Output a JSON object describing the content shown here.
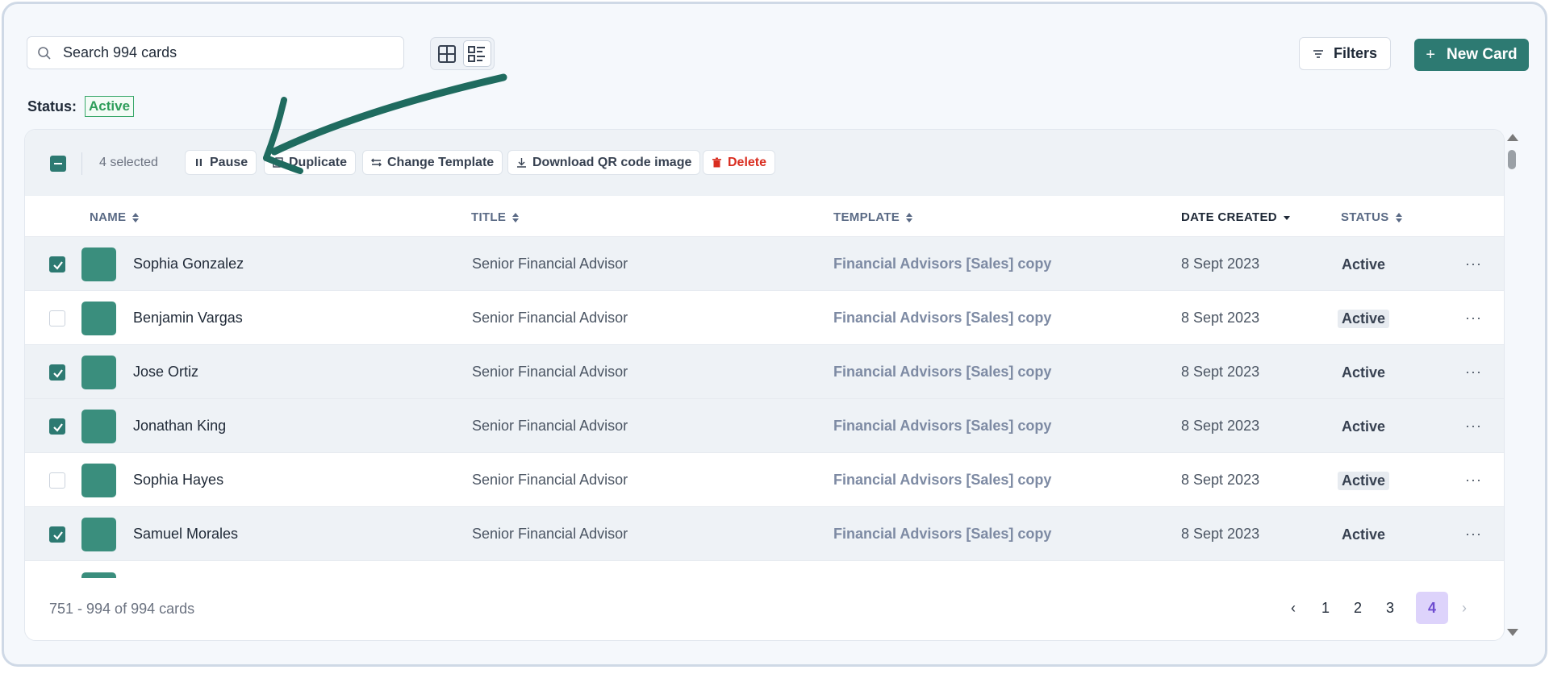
{
  "search": {
    "value": "Search 994 cards",
    "placeholder": "Search 994 cards"
  },
  "toolbar": {
    "filters_label": "Filters",
    "new_card_label": "New Card",
    "new_card_icon": "+"
  },
  "status_filter": {
    "label": "Status:",
    "value": "Active"
  },
  "bulk": {
    "selected_label": "4 selected",
    "actions": [
      {
        "label": "Pause",
        "icon": "pause-icon"
      },
      {
        "label": "Duplicate",
        "icon": "copy-icon"
      },
      {
        "label": "Change Template",
        "icon": "swap-icon"
      },
      {
        "label": "Download QR code image",
        "icon": "download-icon"
      },
      {
        "label": "Delete",
        "icon": "trash-icon"
      }
    ]
  },
  "table": {
    "columns": [
      "NAME",
      "TITLE",
      "TEMPLATE",
      "DATE CREATED",
      "STATUS"
    ],
    "sorted_column": "DATE CREATED",
    "rows": [
      {
        "name": "Sophia Gonzalez",
        "title": "Senior Financial Advisor",
        "template": "Financial Advisors [Sales] copy",
        "date": "8 Sept 2023",
        "status": "Active",
        "selected": true
      },
      {
        "name": "Benjamin Vargas",
        "title": "Senior Financial Advisor",
        "template": "Financial Advisors [Sales] copy",
        "date": "8 Sept 2023",
        "status": "Active",
        "selected": false
      },
      {
        "name": "Jose Ortiz",
        "title": "Senior Financial Advisor",
        "template": "Financial Advisors [Sales] copy",
        "date": "8 Sept 2023",
        "status": "Active",
        "selected": true
      },
      {
        "name": "Jonathan King",
        "title": "Senior Financial Advisor",
        "template": "Financial Advisors [Sales] copy",
        "date": "8 Sept 2023",
        "status": "Active",
        "selected": true
      },
      {
        "name": "Sophia Hayes",
        "title": "Senior Financial Advisor",
        "template": "Financial Advisors [Sales] copy",
        "date": "8 Sept 2023",
        "status": "Active",
        "selected": false
      },
      {
        "name": "Samuel Morales",
        "title": "Senior Financial Advisor",
        "template": "Financial Advisors [Sales] copy",
        "date": "8 Sept 2023",
        "status": "Active",
        "selected": true
      }
    ],
    "row_more": "···"
  },
  "footer": {
    "count_label": "751 - 994 of 994 cards"
  },
  "pagination": {
    "prev": "‹",
    "pages": [
      "1",
      "2",
      "3",
      "4"
    ],
    "current": "4",
    "next": "›"
  },
  "colors": {
    "accent": "#2d7a72",
    "danger": "#d92d20",
    "current_page": "#ddd3fb"
  }
}
